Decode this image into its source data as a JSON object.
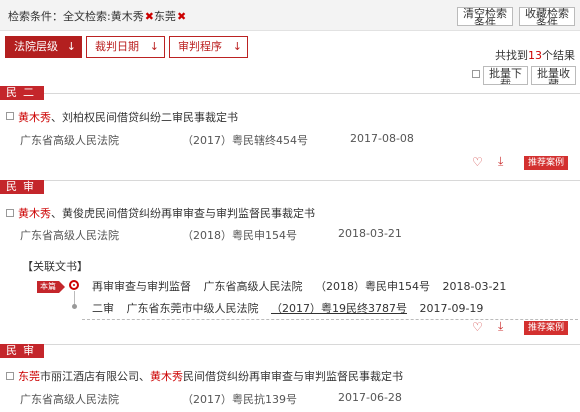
{
  "search": {
    "prefix": "检索条件：全文检索:",
    "terms": [
      "黄木秀",
      "东莞"
    ],
    "remove_glyph": "✖",
    "clear_label": "清空检索条件",
    "save_label": "收藏检索条件"
  },
  "sort": {
    "items": [
      {
        "label": "法院层级",
        "arrow": "↓"
      },
      {
        "label": "裁判日期",
        "arrow": "↓"
      },
      {
        "label": "审判程序",
        "arrow": "↓"
      }
    ],
    "found_prefix": "共找到",
    "found_count": "13",
    "found_suffix": "个结果",
    "batch_download": "批量下载",
    "batch_favorite": "批量收藏"
  },
  "results": [
    {
      "section": "民二",
      "title_hl": "黄木秀",
      "title_rest": "、刘柏权民间借贷纠纷二审民事裁定书",
      "court": "广东省高级人民法院",
      "case_no": "（2017）粤民辖终454号",
      "date": "2017-08-08",
      "recommend": "推荐案例"
    },
    {
      "section": "民审",
      "title_hl": "黄木秀",
      "title_rest": "、黄俊虎民间借贷纠纷再审审查与审判监督民事裁定书",
      "court": "广东省高级人民法院",
      "case_no": "（2018）粤民申154号",
      "date": "2018-03-21",
      "recommend": "推荐案例",
      "related": {
        "title": "【关联文书】",
        "current_badge": "本篇",
        "rows": [
          {
            "stage": "再审审查与审判监督",
            "court": "广东省高级人民法院",
            "case_no": "（2018）粤民申154号",
            "date": "2018-03-21"
          },
          {
            "stage": "二审",
            "court": "广东省东莞市中级人民法院",
            "case_no": "（2017）粤19民终3787号",
            "date": "2017-09-19"
          }
        ]
      }
    },
    {
      "section": "民审",
      "title_parts": [
        "东莞",
        "市丽江酒店有限公司、",
        "黄木秀",
        "民间借贷纠纷再审审查与审判监督民事裁定书"
      ],
      "court": "广东省高级人民法院",
      "case_no": "（2017）粤民抗139号",
      "date": "2017-06-28"
    }
  ],
  "icons": {
    "favorite": "heart-icon",
    "download": "download-icon"
  },
  "colors": {
    "accent": "#c4262b",
    "highlight": "#cc0000"
  }
}
